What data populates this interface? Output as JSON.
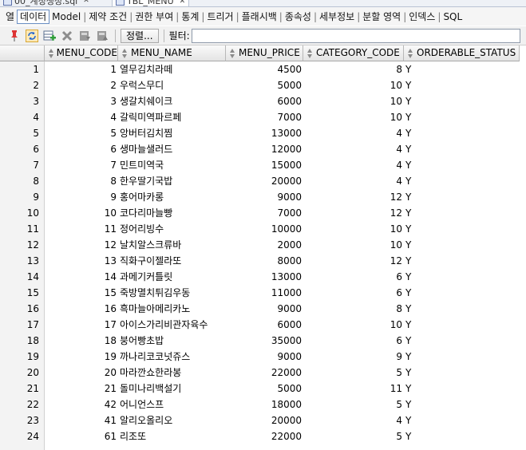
{
  "doc_tabs": [
    {
      "label": "00_계정생성.sql"
    },
    {
      "label": "TBL_MENU"
    }
  ],
  "subtabs": [
    "열",
    "데이터",
    "Model",
    "제약 조건",
    "권한 부여",
    "통계",
    "트리거",
    "플래시백",
    "종속성",
    "세부정보",
    "분할 영역",
    "인덱스",
    "SQL"
  ],
  "toolbar": {
    "icons": [
      "pin-icon",
      "refresh-icon",
      "insert-row-icon",
      "delete-row-icon",
      "commit-icon",
      "rollback-icon"
    ],
    "sort_label": "정렬...",
    "filter_label": "필터:",
    "filter_value": ""
  },
  "grid": {
    "columns": [
      "MENU_CODE",
      "MENU_NAME",
      "MENU_PRICE",
      "CATEGORY_CODE",
      "ORDERABLE_STATUS"
    ],
    "rows": [
      {
        "n": "1",
        "code": "1",
        "name": "열무김치라떼",
        "price": "4500",
        "cat": "8",
        "status": "Y"
      },
      {
        "n": "2",
        "code": "2",
        "name": "우럭스무디",
        "price": "5000",
        "cat": "10",
        "status": "Y"
      },
      {
        "n": "3",
        "code": "3",
        "name": "생갈치쉐이크",
        "price": "6000",
        "cat": "10",
        "status": "Y"
      },
      {
        "n": "4",
        "code": "4",
        "name": "갈릭미역파르페",
        "price": "7000",
        "cat": "10",
        "status": "Y"
      },
      {
        "n": "5",
        "code": "5",
        "name": "앙버터김치찜",
        "price": "13000",
        "cat": "4",
        "status": "Y"
      },
      {
        "n": "6",
        "code": "6",
        "name": "생마늘샐러드",
        "price": "12000",
        "cat": "4",
        "status": "Y"
      },
      {
        "n": "7",
        "code": "7",
        "name": "민트미역국",
        "price": "15000",
        "cat": "4",
        "status": "Y"
      },
      {
        "n": "8",
        "code": "8",
        "name": "한우딸기국밥",
        "price": "20000",
        "cat": "4",
        "status": "Y"
      },
      {
        "n": "9",
        "code": "9",
        "name": "홍어마카롱",
        "price": "9000",
        "cat": "12",
        "status": "Y"
      },
      {
        "n": "10",
        "code": "10",
        "name": "코다리마늘빵",
        "price": "7000",
        "cat": "12",
        "status": "Y"
      },
      {
        "n": "11",
        "code": "11",
        "name": "정어리빙수",
        "price": "10000",
        "cat": "10",
        "status": "Y"
      },
      {
        "n": "12",
        "code": "12",
        "name": "날치알스크류바",
        "price": "2000",
        "cat": "10",
        "status": "Y"
      },
      {
        "n": "13",
        "code": "13",
        "name": "직화구이젤라또",
        "price": "8000",
        "cat": "12",
        "status": "Y"
      },
      {
        "n": "14",
        "code": "14",
        "name": "과메기커틀릿",
        "price": "13000",
        "cat": "6",
        "status": "Y"
      },
      {
        "n": "15",
        "code": "15",
        "name": "죽방멸치튀김우동",
        "price": "11000",
        "cat": "6",
        "status": "Y"
      },
      {
        "n": "16",
        "code": "16",
        "name": "흑마늘아메리카노",
        "price": "9000",
        "cat": "8",
        "status": "Y"
      },
      {
        "n": "17",
        "code": "17",
        "name": "아이스가리비관자육수",
        "price": "6000",
        "cat": "10",
        "status": "Y"
      },
      {
        "n": "18",
        "code": "18",
        "name": "붕어빵초밥",
        "price": "35000",
        "cat": "6",
        "status": "Y"
      },
      {
        "n": "19",
        "code": "19",
        "name": "까나리코코넛쥬스",
        "price": "9000",
        "cat": "9",
        "status": "Y"
      },
      {
        "n": "20",
        "code": "20",
        "name": "마라깐쇼한라봉",
        "price": "22000",
        "cat": "5",
        "status": "Y"
      },
      {
        "n": "21",
        "code": "21",
        "name": "돌미나리백설기",
        "price": "5000",
        "cat": "11",
        "status": "Y"
      },
      {
        "n": "22",
        "code": "42",
        "name": "어니언스프",
        "price": "18000",
        "cat": "5",
        "status": "Y"
      },
      {
        "n": "23",
        "code": "41",
        "name": "알리오올리오",
        "price": "20000",
        "cat": "4",
        "status": "Y"
      },
      {
        "n": "24",
        "code": "61",
        "name": "리조또",
        "price": "22000",
        "cat": "5",
        "status": "Y"
      }
    ]
  }
}
